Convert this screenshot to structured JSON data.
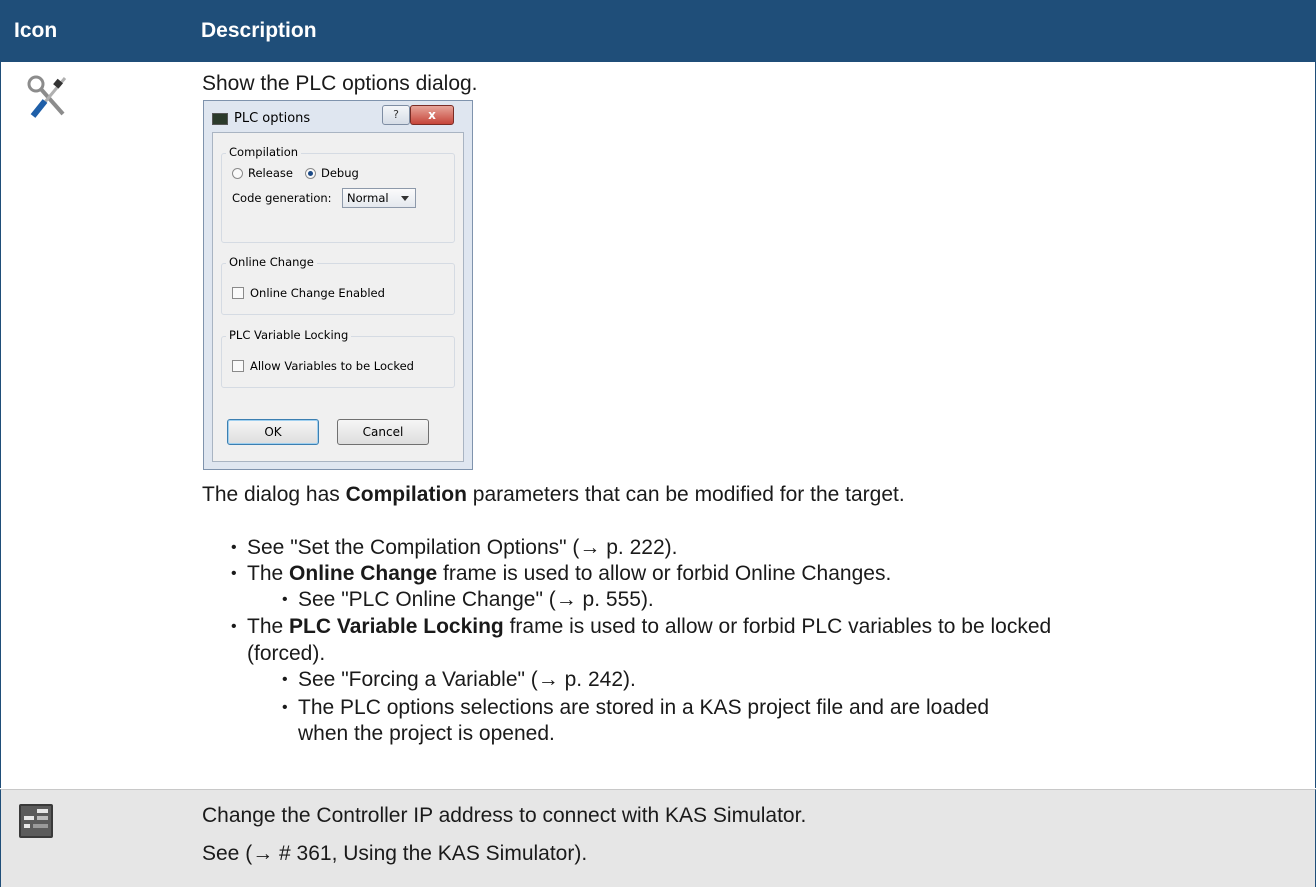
{
  "header": {
    "icon_col": "Icon",
    "desc_col": "Description"
  },
  "row1": {
    "icon": "tools-icon",
    "intro": "Show the PLC options dialog.",
    "dialog": {
      "title": "PLC options",
      "help_label": "?",
      "close_label": "x",
      "compilation_group": "Compilation",
      "release_label": "Release",
      "debug_label": "Debug",
      "selected_mode": "Debug",
      "code_generation_label": "Code generation:",
      "code_generation_value": "Normal",
      "online_change_group": "Online Change",
      "online_change_checkbox": "Online Change Enabled",
      "online_change_checked": false,
      "locking_group": "PLC Variable Locking",
      "locking_checkbox": "Allow Variables to be Locked",
      "locking_checked": false,
      "ok_label": "OK",
      "cancel_label": "Cancel"
    },
    "para_pre": "The dialog has ",
    "para_bold": "Compilation",
    "para_post": " parameters that can be modified for the target.",
    "b1": "See \"Set the Compilation Options\" (→ p. 222).",
    "b2_pre": "The ",
    "b2_bold": "Online Change",
    "b2_post": " frame is used to allow or forbid Online Changes.",
    "b2_sub": "See \"PLC Online Change\" (→ p. 555).",
    "b3_pre": "The ",
    "b3_bold": "PLC Variable Locking",
    "b3_post": " frame is used to allow or forbid PLC variables to be locked",
    "b3_cont": "(forced).",
    "b3_sub1": "See \"Forcing a Variable\" (→ p. 242).",
    "b3_sub2_l1": "The PLC options selections are stored in a KAS project file and are loaded",
    "b3_sub2_l2": "when the project is opened."
  },
  "row2": {
    "icon": "ip-address-icon",
    "line1": "Change the Controller IP address to connect with KAS Simulator.",
    "line2": "See (→ # 361, Using the KAS Simulator)."
  },
  "colors": {
    "header_bg": "#1f4e79",
    "row2_bg": "#e6e6e6"
  }
}
